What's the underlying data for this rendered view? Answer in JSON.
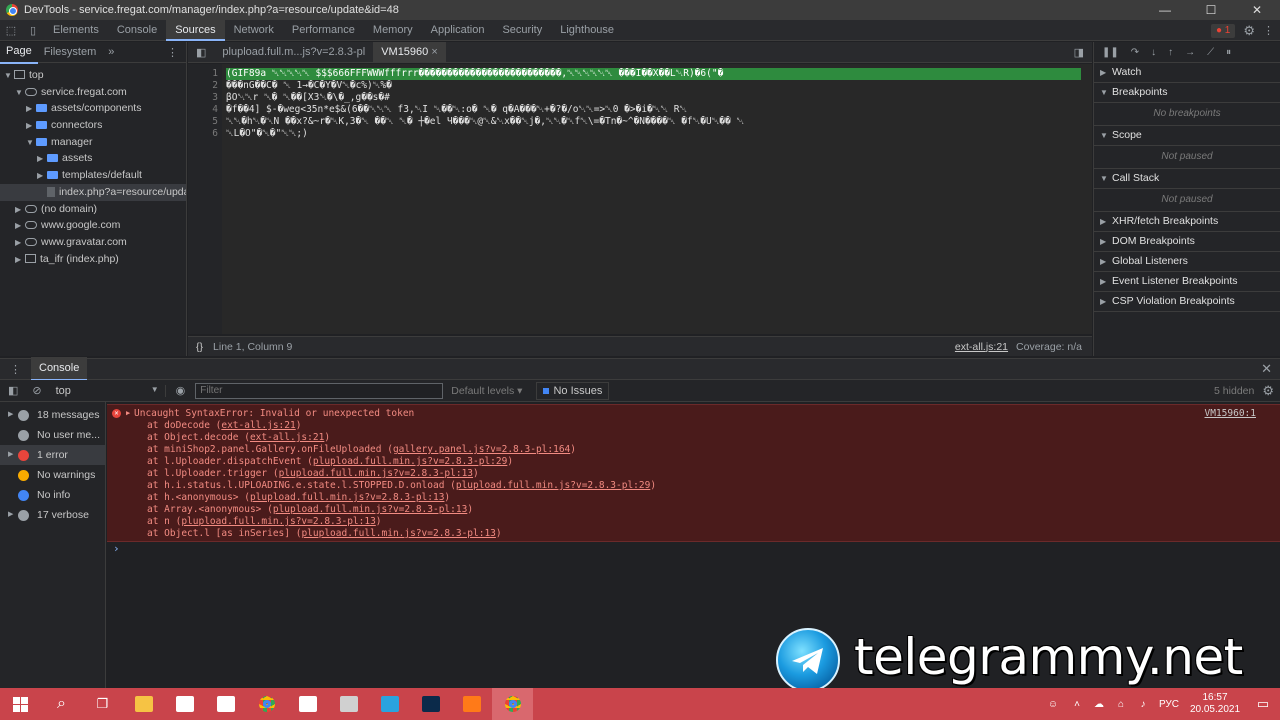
{
  "window": {
    "title": "DevTools - service.fregat.com/manager/index.php?a=resource/update&id=48",
    "controls": [
      "—",
      "☐",
      "✕"
    ]
  },
  "devtools_tabs": [
    "Elements",
    "Console",
    "Sources",
    "Network",
    "Performance",
    "Memory",
    "Application",
    "Security",
    "Lighthouse"
  ],
  "active_tab": "Sources",
  "error_count": "1",
  "navigator": {
    "tabs": [
      "Page",
      "Filesystem"
    ],
    "tree": [
      {
        "label": "top",
        "depth": 0,
        "kind": "frame",
        "open": true
      },
      {
        "label": "service.fregat.com",
        "depth": 1,
        "kind": "cloud",
        "open": true
      },
      {
        "label": "assets/components",
        "depth": 2,
        "kind": "folder",
        "open": false
      },
      {
        "label": "connectors",
        "depth": 2,
        "kind": "folder",
        "open": false
      },
      {
        "label": "manager",
        "depth": 2,
        "kind": "folder",
        "open": true
      },
      {
        "label": "assets",
        "depth": 3,
        "kind": "folder",
        "open": false
      },
      {
        "label": "templates/default",
        "depth": 3,
        "kind": "folder",
        "open": false
      },
      {
        "label": "index.php?a=resource/update",
        "depth": 3,
        "kind": "file",
        "selected": true
      },
      {
        "label": "(no domain)",
        "depth": 1,
        "kind": "cloud",
        "open": false
      },
      {
        "label": "www.google.com",
        "depth": 1,
        "kind": "cloud",
        "open": false
      },
      {
        "label": "www.gravatar.com",
        "depth": 1,
        "kind": "cloud",
        "open": false
      },
      {
        "label": "ta_ifr (index.php)",
        "depth": 1,
        "kind": "frame",
        "open": false
      }
    ]
  },
  "editor": {
    "tabs": [
      {
        "label": "plupload.full.m...js?v=2.8.3-pl",
        "active": false
      },
      {
        "label": "VM15960",
        "active": true
      }
    ],
    "lines": [
      {
        "n": "1",
        "text": "(GIF89a ␀␀␀␀␀ $$$666FFFWWWfffrrr�������������������������,␀␀␀␀␀␀ ���I��X��L␀R)�6(\"�",
        "hl": true
      },
      {
        "n": "2",
        "text": "���nG��C� ␀ 1→�C�Y�V␀�c%)␀%�"
      },
      {
        "n": "3",
        "text": "βO␀␀r ␀� ␀��[X3␀�\\�_,g��s�#"
      },
      {
        "n": "4",
        "text": "�f��4] $-�weg<35n*e$&(6��␀␀␀ f3,␀I ␀��␀:o� ␀� q�A���␀+�?�/o␀␀=>␀0 �>�i�␀␀     R␀"
      },
      {
        "n": "5",
        "text": "␀␀�h␀�␀N ��x?&~r�␀K,3�␀ ��␀ ␀� ┼�el Ч���␀@␀&␀x��␀j�,␀␀�␀f␀\\=�Tn�~^�N����␀    �f␀�U␀��    ␀"
      },
      {
        "n": "6",
        "text": "␀L�O\"�␀�\"␀␀;)"
      }
    ],
    "status_left": "Line 1, Column 9",
    "status_link": "ext-all.js:21",
    "status_coverage": "Coverage: n/a",
    "format_icon": "{}"
  },
  "debugger": {
    "sections": [
      {
        "label": "Watch",
        "open": false
      },
      {
        "label": "Breakpoints",
        "open": true,
        "body": "No breakpoints"
      },
      {
        "label": "Scope",
        "open": true,
        "body": "Not paused"
      },
      {
        "label": "Call Stack",
        "open": true,
        "body": "Not paused"
      },
      {
        "label": "XHR/fetch Breakpoints",
        "open": false
      },
      {
        "label": "DOM Breakpoints",
        "open": false
      },
      {
        "label": "Global Listeners",
        "open": false
      },
      {
        "label": "Event Listener Breakpoints",
        "open": false
      },
      {
        "label": "CSP Violation Breakpoints",
        "open": false
      }
    ]
  },
  "console": {
    "drawer_tab": "Console",
    "context": "top",
    "filter_placeholder": "Filter",
    "levels": "Default levels",
    "issues": "No Issues",
    "hidden": "5 hidden",
    "sidebar": [
      {
        "label": "18 messages",
        "icon": "list-icon",
        "color": "#9aa0a6"
      },
      {
        "label": "No user me...",
        "icon": "user-icon",
        "color": "#9aa0a6"
      },
      {
        "label": "1 error",
        "icon": "error-icon",
        "color": "#e8453c",
        "selected": true
      },
      {
        "label": "No warnings",
        "icon": "warning-icon",
        "color": "#f9ab00"
      },
      {
        "label": "No info",
        "icon": "info-icon",
        "color": "#4285f4"
      },
      {
        "label": "17 verbose",
        "icon": "verbose-icon",
        "color": "#9aa0a6"
      }
    ],
    "error": {
      "message": "Uncaught SyntaxError: Invalid or unexpected token",
      "source": "VM15960:1",
      "stack": [
        {
          "fn": "at doDecode (",
          "link": "ext-all.js:21",
          "tail": ")"
        },
        {
          "fn": "at Object.decode (",
          "link": "ext-all.js:21",
          "tail": ")"
        },
        {
          "fn": "at miniShop2.panel.Gallery.onFileUploaded (",
          "link": "gallery.panel.js?v=2.8.3-pl:164",
          "tail": ")"
        },
        {
          "fn": "at l.Uploader.dispatchEvent (",
          "link": "plupload.full.min.js?v=2.8.3-pl:29",
          "tail": ")"
        },
        {
          "fn": "at l.Uploader.trigger (",
          "link": "plupload.full.min.js?v=2.8.3-pl:13",
          "tail": ")"
        },
        {
          "fn": "at h.i.status.l.UPLOADING.e.state.l.STOPPED.D.onload (",
          "link": "plupload.full.min.js?v=2.8.3-pl:29",
          "tail": ")"
        },
        {
          "fn": "at h.<anonymous> (",
          "link": "plupload.full.min.js?v=2.8.3-pl:13",
          "tail": ")"
        },
        {
          "fn": "at Array.<anonymous> (",
          "link": "plupload.full.min.js?v=2.8.3-pl:13",
          "tail": ")"
        },
        {
          "fn": "at n (",
          "link": "plupload.full.min.js?v=2.8.3-pl:13",
          "tail": ")"
        },
        {
          "fn": "at Object.l [as inSeries] (",
          "link": "plupload.full.min.js?v=2.8.3-pl:13",
          "tail": ")"
        }
      ]
    },
    "prompt": "›"
  },
  "watermark": {
    "text": "telegrammy.net"
  },
  "taskbar": {
    "apps": [
      {
        "icon": "windows-start-icon",
        "color": "#ffffff"
      },
      {
        "icon": "search-icon",
        "color": "#ffffff"
      },
      {
        "icon": "task-view-icon",
        "color": "#ffffff"
      },
      {
        "icon": "file-explorer-icon",
        "color": "#f6c344"
      },
      {
        "icon": "store-icon",
        "color": "#ffffff"
      },
      {
        "icon": "mail-icon",
        "color": "#ffffff"
      },
      {
        "icon": "chrome-icon",
        "color": "#34a853"
      },
      {
        "icon": "app-icon",
        "color": "#ffffff"
      },
      {
        "icon": "app2-icon",
        "color": "#d0d0d0"
      },
      {
        "icon": "telegram-icon",
        "color": "#2aa3df"
      },
      {
        "icon": "photoshop-icon",
        "color": "#0b2a4a"
      },
      {
        "icon": "firefox-icon",
        "color": "#ff7a18"
      },
      {
        "icon": "chrome-active-icon",
        "color": "#34a853"
      }
    ],
    "lang": "РУС",
    "time": "16:57",
    "date": "20.05.2021"
  }
}
